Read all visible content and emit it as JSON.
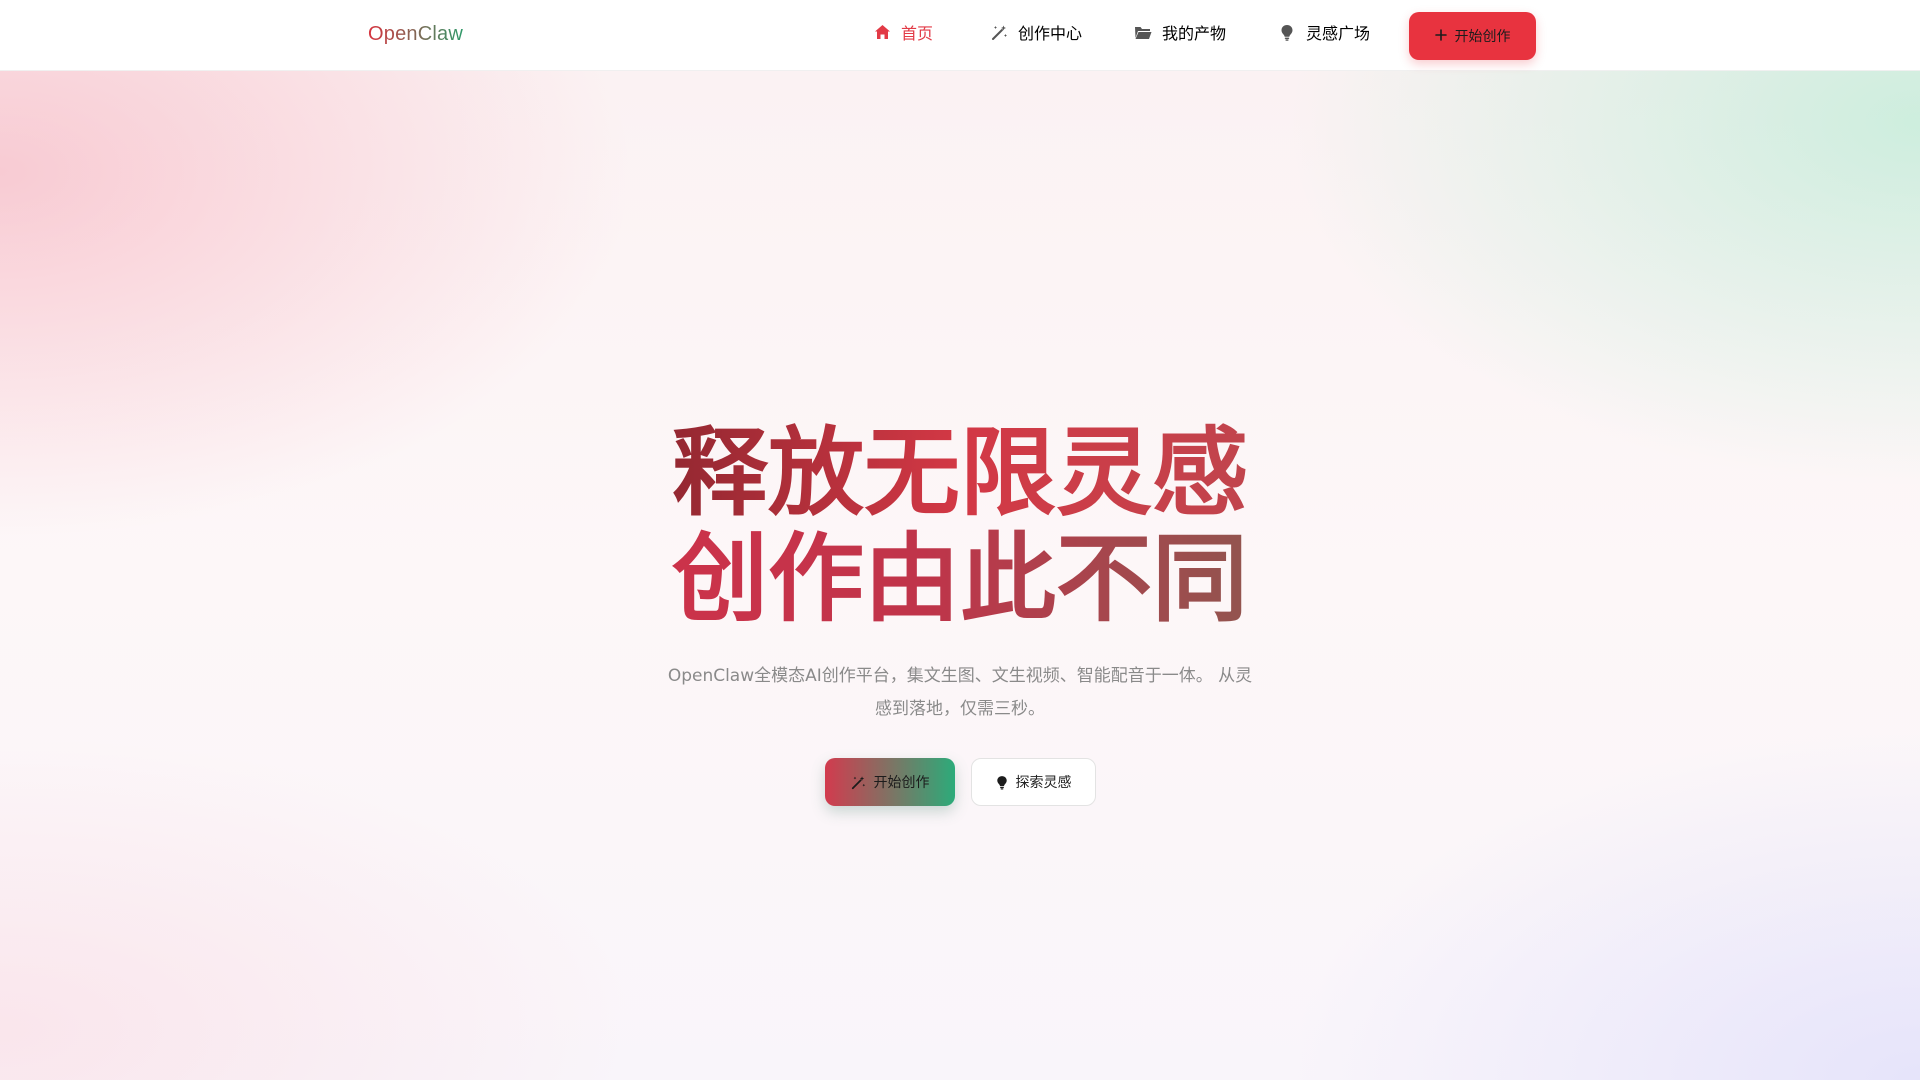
{
  "header": {
    "logo": "OpenClaw",
    "nav": [
      {
        "label": "首页",
        "icon": "home-icon",
        "active": true
      },
      {
        "label": "创作中心",
        "icon": "magic-wand-icon",
        "active": false
      },
      {
        "label": "我的产物",
        "icon": "folder-icon",
        "active": false
      },
      {
        "label": "灵感广场",
        "icon": "lightbulb-icon",
        "active": false
      }
    ],
    "cta_label": "开始创作",
    "cta_icon": "plus-icon"
  },
  "hero": {
    "title_line1": "释放无限灵感",
    "title_line2": "创作由此不同",
    "subtitle": "OpenClaw全模态AI创作平台，集文生图、文生视频、智能配音于一体。 从灵感到落地，仅需三秒。",
    "primary_button": {
      "label": "开始创作",
      "icon": "magic-wand-icon"
    },
    "secondary_button": {
      "label": "探索灵感",
      "icon": "lightbulb-icon"
    }
  },
  "colors": {
    "accent_red": "#e8333f",
    "accent_green": "#2cab7a",
    "nav_active": "#e23a46",
    "subtitle_gray": "#8a8a8a"
  }
}
